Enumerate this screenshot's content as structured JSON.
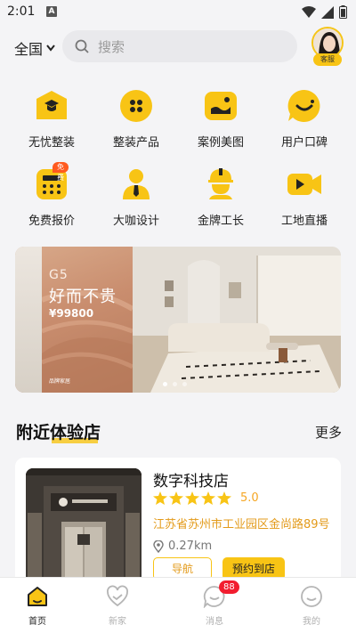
{
  "status": {
    "time": "2:01",
    "notif_letter": "A"
  },
  "header": {
    "city": "全国",
    "search_placeholder": "搜索",
    "avatar_badge": "客服"
  },
  "menu": [
    {
      "label": "无忧整装",
      "icon": "house-hat-icon"
    },
    {
      "label": "整装产品",
      "icon": "grid-dots-icon"
    },
    {
      "label": "案例美图",
      "icon": "photo-icon"
    },
    {
      "label": "用户口碑",
      "icon": "smile-chat-icon"
    },
    {
      "label": "免费报价",
      "icon": "calculator-icon",
      "tag": "免费"
    },
    {
      "label": "大咖设计",
      "icon": "designer-icon"
    },
    {
      "label": "金牌工长",
      "icon": "helmet-worker-icon"
    },
    {
      "label": "工地直播",
      "icon": "video-camera-icon"
    }
  ],
  "banner": {
    "series": "G5",
    "slogan": "好而不贵",
    "price": "¥99800",
    "brand": "品牌家居"
  },
  "nearby": {
    "title": "附近体验店",
    "more": "更多",
    "store": {
      "name": "数字科技店",
      "rating": "5.0",
      "stars": 5,
      "address": "江苏省苏州市工业园区金尚路89号",
      "distance": "0.27km",
      "nav_label": "导航",
      "book_label": "预约到店"
    }
  },
  "tabs": [
    {
      "label": "首页",
      "active": true
    },
    {
      "label": "新家",
      "active": false
    },
    {
      "label": "消息",
      "active": false,
      "badge": "88"
    },
    {
      "label": "我的",
      "active": false
    }
  ],
  "colors": {
    "accent": "#f8c415",
    "orange": "#e39b1b",
    "badge": "#f21d2f",
    "background": "#f4f4f6"
  }
}
